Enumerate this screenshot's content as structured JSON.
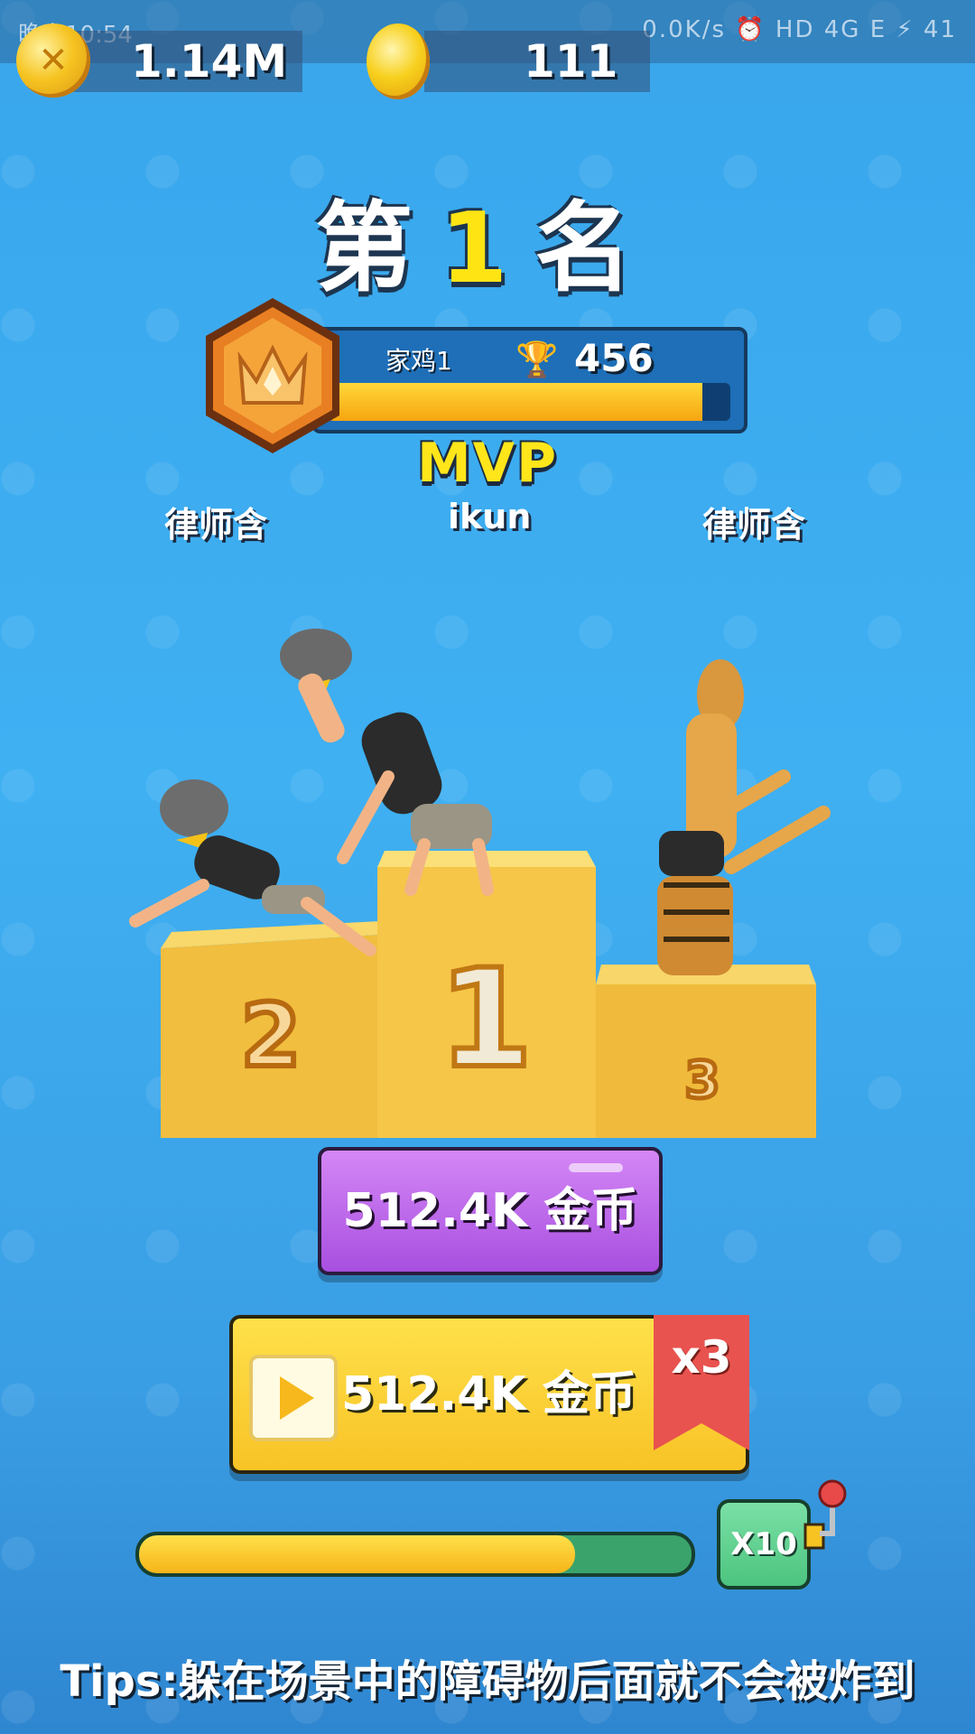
{
  "statusbar": {
    "time": "晚上10:54",
    "right": "0.0K/s ⏰ HD 4G E ⚡ 41"
  },
  "resources": {
    "gold": "1.14M",
    "gems": "111"
  },
  "result": {
    "rank_prefix": "第",
    "rank_number": "1",
    "rank_suffix": "名"
  },
  "player_card": {
    "name": "家鸡1",
    "trophies": "456",
    "progress": 0.93
  },
  "mvp_label": "MVP",
  "podium": {
    "names": {
      "second": "律师含",
      "first": "ikun",
      "third": "律师含"
    },
    "places": [
      "1",
      "2",
      "3"
    ]
  },
  "rewards": {
    "claim_label": "512.4K 金币",
    "video_label": "512.4K 金币",
    "multiplier": "x3"
  },
  "spin": {
    "progress": 0.79,
    "multiplier_label": "X10"
  },
  "tips": "Tips:躲在场景中的障碍物后面就不会被炸到",
  "colors": {
    "gold": "#f7c21e",
    "purple": "#b861e6",
    "green": "#4cc47f",
    "red": "#e8534f"
  }
}
